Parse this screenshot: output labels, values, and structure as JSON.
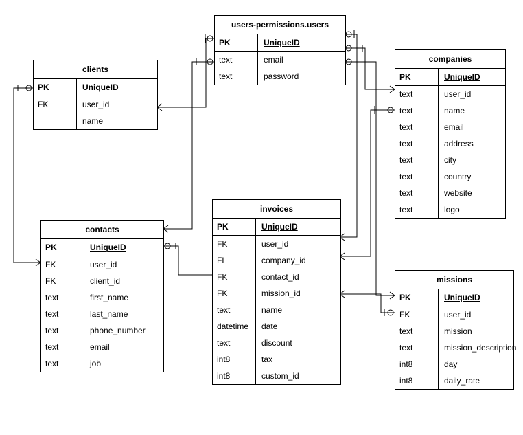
{
  "chart_data": {
    "type": "entity-relationship-diagram",
    "entities": {
      "users": {
        "title": "users-permissions.users",
        "header_key": "PK",
        "header_name": "UniqueID",
        "rows": [
          {
            "key": "text",
            "name": "email"
          },
          {
            "key": "text",
            "name": "password"
          }
        ]
      },
      "clients": {
        "title": "clients",
        "header_key": "PK",
        "header_name": "UniqueID",
        "rows": [
          {
            "key": "FK",
            "name": "user_id"
          },
          {
            "key": "",
            "name": "name"
          }
        ]
      },
      "companies": {
        "title": "companies",
        "header_key": "PK",
        "header_name": "UniqueID",
        "rows": [
          {
            "key": "text",
            "name": "user_id"
          },
          {
            "key": "text",
            "name": "name"
          },
          {
            "key": "text",
            "name": "email"
          },
          {
            "key": "text",
            "name": "address"
          },
          {
            "key": "text",
            "name": "city"
          },
          {
            "key": "text",
            "name": "country"
          },
          {
            "key": "text",
            "name": "website"
          },
          {
            "key": "text",
            "name": "logo"
          }
        ]
      },
      "contacts": {
        "title": "contacts",
        "header_key": "PK",
        "header_name": "UniqueID",
        "rows": [
          {
            "key": "FK",
            "name": "user_id"
          },
          {
            "key": "FK",
            "name": "client_id"
          },
          {
            "key": "text",
            "name": "first_name"
          },
          {
            "key": "text",
            "name": "last_name"
          },
          {
            "key": "text",
            "name": "phone_number"
          },
          {
            "key": "text",
            "name": "email"
          },
          {
            "key": "text",
            "name": "job"
          }
        ]
      },
      "invoices": {
        "title": "invoices",
        "header_key": "PK",
        "header_name": "UniqueID",
        "rows": [
          {
            "key": "FK",
            "name": "user_id"
          },
          {
            "key": "FL",
            "name": "company_id"
          },
          {
            "key": "FK",
            "name": "contact_id"
          },
          {
            "key": "FK",
            "name": "mission_id"
          },
          {
            "key": "text",
            "name": "name"
          },
          {
            "key": "datetime",
            "name": "date"
          },
          {
            "key": "text",
            "name": "discount"
          },
          {
            "key": "int8",
            "name": "tax"
          },
          {
            "key": "int8",
            "name": "custom_id"
          }
        ]
      },
      "missions": {
        "title": "missions",
        "header_key": "PK",
        "header_name": "UniqueID",
        "rows": [
          {
            "key": "FK",
            "name": "user_id"
          },
          {
            "key": "text",
            "name": "mission"
          },
          {
            "key": "text",
            "name": "mission_description"
          },
          {
            "key": "int8",
            "name": "day"
          },
          {
            "key": "int8",
            "name": "daily_rate"
          }
        ]
      }
    },
    "relationships": [
      {
        "from": "clients.user_id",
        "to": "users-permissions.users",
        "type": "many-to-one"
      },
      {
        "from": "contacts.user_id",
        "to": "users-permissions.users",
        "type": "many-to-one"
      },
      {
        "from": "contacts.client_id",
        "to": "clients",
        "type": "many-to-one"
      },
      {
        "from": "invoices.user_id",
        "to": "users-permissions.users",
        "type": "many-to-one"
      },
      {
        "from": "invoices.company_id",
        "to": "companies",
        "type": "many-to-one"
      },
      {
        "from": "invoices.contact_id",
        "to": "contacts",
        "type": "many-to-one"
      },
      {
        "from": "invoices.mission_id",
        "to": "missions",
        "type": "many-to-one"
      },
      {
        "from": "companies.user_id",
        "to": "users-permissions.users",
        "type": "many-to-one"
      },
      {
        "from": "missions.user_id",
        "to": "users-permissions.users",
        "type": "many-to-one"
      }
    ]
  }
}
